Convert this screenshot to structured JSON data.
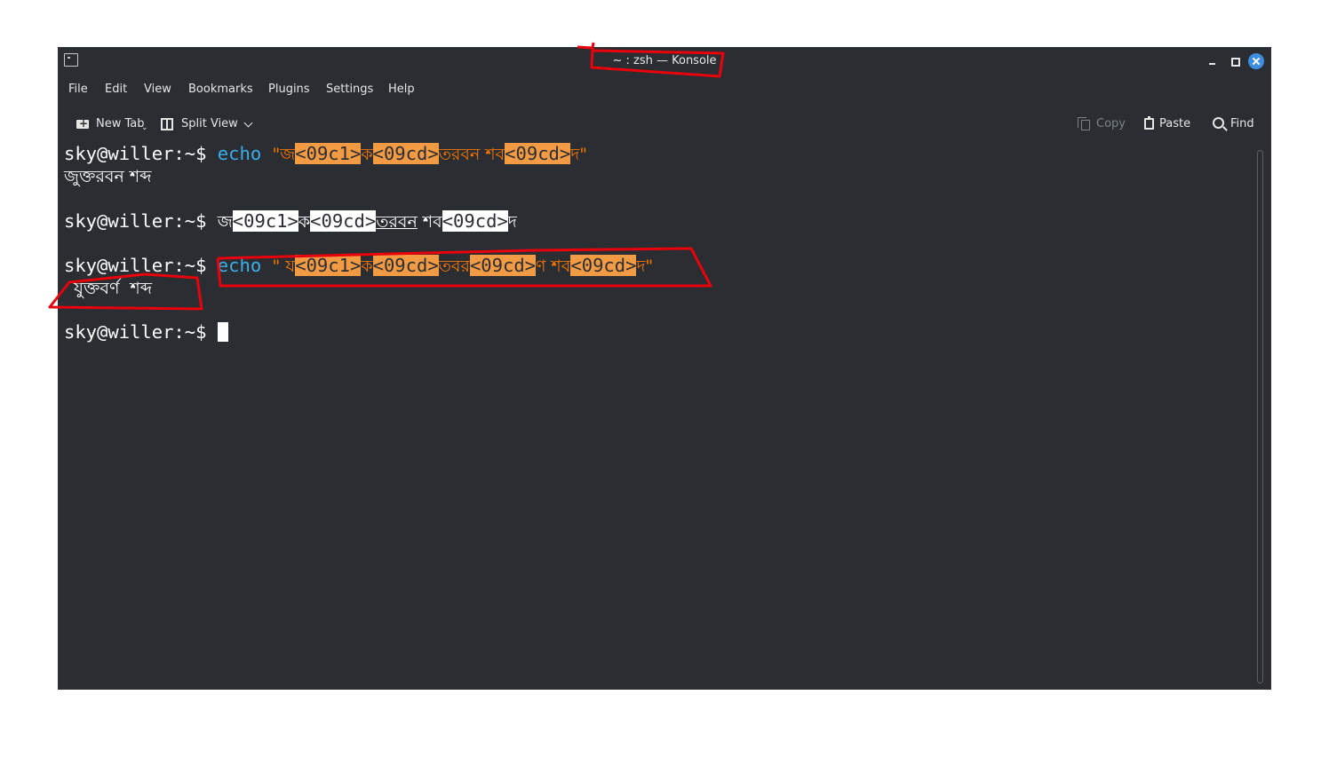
{
  "window": {
    "title": "~ : zsh — Konsole"
  },
  "menu": [
    "File",
    "Edit",
    "View",
    "Bookmarks",
    "Plugins",
    "Settings",
    "Help"
  ],
  "toolbar": {
    "new_tab": "New Tab",
    "split_view": "Split View",
    "copy": "Copy",
    "paste": "Paste",
    "find": "Find"
  },
  "icons": {
    "app": "terminal-icon",
    "new_tab": "new-tab-icon",
    "split_view": "split-view-icon",
    "copy": "copy-icon",
    "paste": "paste-icon",
    "find": "search-icon",
    "minimize": "minimize-icon",
    "maximize": "maximize-icon",
    "close": "close-icon"
  },
  "terminal": {
    "prompt": "sky@willer:~$",
    "line1": {
      "cmd": "echo",
      "s1": "\"জ",
      "c1": "<09c1>",
      "s2": "ক",
      "c2": "<09cd>",
      "s3": "তরবন শব",
      "c3": "<09cd>",
      "s4": "দ\""
    },
    "output1": "জুক্তরবন শব্দ",
    "line2": {
      "s1": "জ",
      "c1": "<09c1>",
      "s2": "ক",
      "c2": "<09cd>",
      "s3": "তরবন",
      "s4": " শব",
      "c3": "<09cd>",
      "s5": "দ"
    },
    "line3": {
      "cmd": "echo",
      "s1": "\" য",
      "c1": "<09c1>",
      "s2": "ক",
      "c2": "<09cd>",
      "s3": "তবর",
      "c3": "<09cd>",
      "s4": "ণ শব",
      "c4": "<09cd>",
      "s5": "দ\""
    },
    "output3": "যুক্তবর্ণ  শব্দ"
  },
  "colors": {
    "background": "#2a2e32",
    "command": "#3daee9",
    "string": "#f67400",
    "highlight": "#f29a44",
    "annotation": "#e8000b",
    "accent": "#3d8ee0"
  }
}
